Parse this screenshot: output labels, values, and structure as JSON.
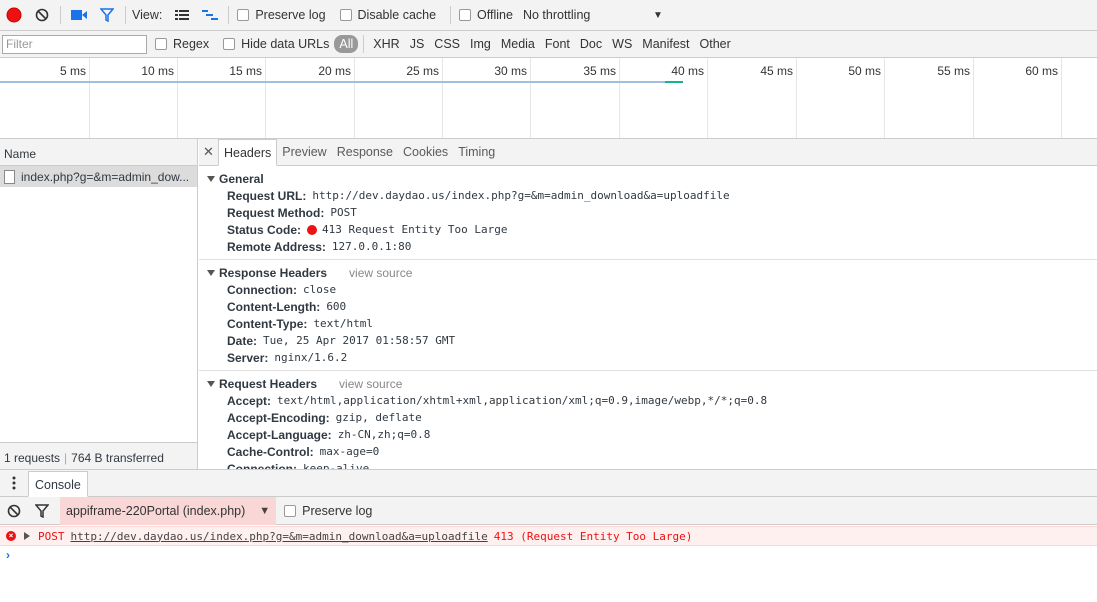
{
  "toolbar": {
    "view_label": "View:",
    "preserve_log": "Preserve log",
    "disable_cache": "Disable cache",
    "offline": "Offline",
    "throttling": "No throttling"
  },
  "filterbar": {
    "placeholder": "Filter",
    "regex": "Regex",
    "hide_data_urls": "Hide data URLs",
    "types": [
      "All",
      "XHR",
      "JS",
      "CSS",
      "Img",
      "Media",
      "Font",
      "Doc",
      "WS",
      "Manifest",
      "Other"
    ]
  },
  "timeline": {
    "ticks": [
      "5 ms",
      "10 ms",
      "15 ms",
      "20 ms",
      "25 ms",
      "30 ms",
      "35 ms",
      "40 ms",
      "45 ms",
      "50 ms",
      "55 ms",
      "60 ms"
    ]
  },
  "requests": {
    "header": "Name",
    "items": [
      "index.php?g=&m=admin_dow..."
    ],
    "count": "1 requests",
    "transferred": "764 B transferred"
  },
  "details": {
    "tabs": [
      "Headers",
      "Preview",
      "Response",
      "Cookies",
      "Timing"
    ],
    "general": {
      "title": "General",
      "rows": [
        {
          "key": "Request URL:",
          "value": "http://dev.daydao.us/index.php?g=&m=admin_download&a=uploadfile"
        },
        {
          "key": "Request Method:",
          "value": "POST"
        },
        {
          "key": "Status Code:",
          "value": "413 Request Entity Too Large"
        },
        {
          "key": "Remote Address:",
          "value": "127.0.0.1:80"
        }
      ]
    },
    "response_headers": {
      "title": "Response Headers",
      "view_source": "view source",
      "rows": [
        {
          "key": "Connection:",
          "value": "close"
        },
        {
          "key": "Content-Length:",
          "value": "600"
        },
        {
          "key": "Content-Type:",
          "value": "text/html"
        },
        {
          "key": "Date:",
          "value": "Tue, 25 Apr 2017 01:58:57 GMT"
        },
        {
          "key": "Server:",
          "value": "nginx/1.6.2"
        }
      ]
    },
    "request_headers": {
      "title": "Request Headers",
      "view_source": "view source",
      "rows": [
        {
          "key": "Accept:",
          "value": "text/html,application/xhtml+xml,application/xml;q=0.9,image/webp,*/*;q=0.8"
        },
        {
          "key": "Accept-Encoding:",
          "value": "gzip, deflate"
        },
        {
          "key": "Accept-Language:",
          "value": "zh-CN,zh;q=0.8"
        },
        {
          "key": "Cache-Control:",
          "value": "max-age=0"
        },
        {
          "key": "Connection:",
          "value": "keep-alive"
        }
      ]
    }
  },
  "console": {
    "tab": "Console",
    "context": "appiframe-220Portal (index.php)",
    "preserve_log": "Preserve log",
    "error": {
      "method": "POST",
      "url": "http://dev.daydao.us/index.php?g=&m=admin_download&a=uploadfile",
      "status": "413 (Request Entity Too Large)"
    },
    "prompt": "›"
  },
  "colors": {
    "record": "#e11",
    "error_bg": "#fff0f0",
    "accent": "#1a73e8"
  },
  "icons": [
    "record-icon",
    "clear-icon",
    "camera-icon",
    "filter-icon",
    "list-view-icon",
    "waterfall-view-icon",
    "dropdown-arrow-icon",
    "close-icon",
    "kebab-menu-icon",
    "error-icon",
    "expand-triangle-icon"
  ]
}
